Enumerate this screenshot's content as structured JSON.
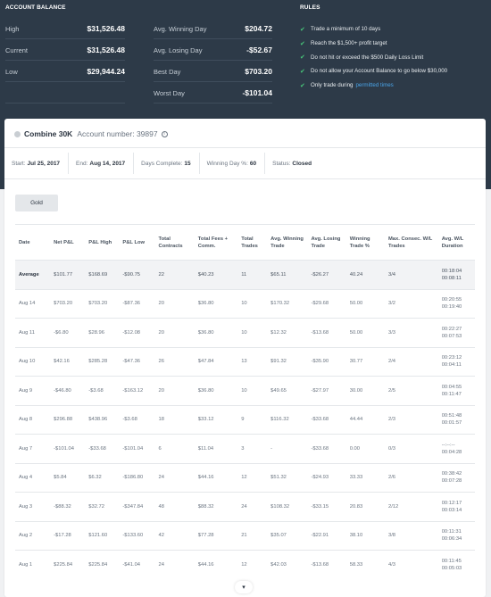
{
  "account_balance": {
    "title": "ACCOUNT BALANCE",
    "left": [
      {
        "label": "High",
        "value": "$31,526.48"
      },
      {
        "label": "Current",
        "value": "$31,526.48"
      },
      {
        "label": "Low",
        "value": "$29,944.24"
      }
    ],
    "right": [
      {
        "label": "Avg. Winning Day",
        "value": "$204.72"
      },
      {
        "label": "Avg. Losing Day",
        "value": "-$52.67"
      },
      {
        "label": "Best Day",
        "value": "$703.20"
      },
      {
        "label": "Worst Day",
        "value": "-$101.04"
      }
    ]
  },
  "rules": {
    "title": "RULES",
    "items": [
      "Trade a minimum of 10 days",
      "Reach the $1,500+ profit target",
      "Do not hit or exceed the $500 Daily Loss Limit",
      "Do not allow your Account Balance to go below $30,000",
      "Only trade during"
    ],
    "link": "permitted times",
    "check_color": "#48c77a",
    "link_color": "#4aa4e8"
  },
  "combine": {
    "name": "Combine 30K",
    "account_label": "Account number: 39897",
    "start_label": "Start:",
    "start": "Jul 25, 2017",
    "end_label": "End:",
    "end": "Aug 14, 2017",
    "days_label": "Days Complete:",
    "days": "15",
    "win_label": "Winning Day %:",
    "win": "60",
    "status_label": "Status:",
    "status": "Closed",
    "gold_button": "Gold"
  },
  "table": {
    "headers": [
      "Date",
      "Net P&L",
      "P&L High",
      "P&L Low",
      "Total Contracts",
      "Total Fees + Comm.",
      "Total Trades",
      "Avg. Winning Trade",
      "Avg. Losing Trade",
      "Winning Trade %",
      "Max. Consec. W/L Trades",
      "Avg. W/L Duration"
    ],
    "rows": [
      [
        "Average",
        "$101.77",
        "$168.69",
        "-$90.75",
        "22",
        "$40.23",
        "11",
        "$65.11",
        "-$26.27",
        "40.24",
        "3/4",
        "00:18:04\n00:08:11"
      ],
      [
        "Aug 14",
        "$703.20",
        "$703.20",
        "-$87.36",
        "20",
        "$36.80",
        "10",
        "$170.32",
        "-$29.68",
        "50.00",
        "3/2",
        "00:20:55\n00:19:40"
      ],
      [
        "Aug 11",
        "-$6.80",
        "$28.96",
        "-$12.08",
        "20",
        "$36.80",
        "10",
        "$12.32",
        "-$13.68",
        "50.00",
        "3/3",
        "00:22:27\n00:07:53"
      ],
      [
        "Aug 10",
        "$42.16",
        "$285.28",
        "-$47.36",
        "26",
        "$47.84",
        "13",
        "$91.32",
        "-$35.90",
        "30.77",
        "2/4",
        "00:23:12\n00:04:11"
      ],
      [
        "Aug 9",
        "-$46.80",
        "-$3.68",
        "-$163.12",
        "20",
        "$36.80",
        "10",
        "$49.65",
        "-$27.97",
        "30.00",
        "2/5",
        "00:04:55\n00:11:47"
      ],
      [
        "Aug 8",
        "$296.88",
        "$438.96",
        "-$3.68",
        "18",
        "$33.12",
        "9",
        "$116.32",
        "-$33.68",
        "44.44",
        "2/3",
        "00:51:48\n00:01:57"
      ],
      [
        "Aug 7",
        "-$101.04",
        "-$33.68",
        "-$101.04",
        "6",
        "$11.04",
        "3",
        "-",
        "-$33.68",
        "0.00",
        "0/3",
        "--:--:--\n00:04:28"
      ],
      [
        "Aug 4",
        "$5.84",
        "$6.32",
        "-$186.80",
        "24",
        "$44.16",
        "12",
        "$51.32",
        "-$24.93",
        "33.33",
        "2/6",
        "00:38:42\n00:07:28"
      ],
      [
        "Aug 3",
        "-$88.32",
        "$32.72",
        "-$347.84",
        "48",
        "$88.32",
        "24",
        "$108.32",
        "-$33.15",
        "20.83",
        "2/12",
        "00:12:17\n00:03:14"
      ],
      [
        "Aug 2",
        "-$17.28",
        "$121.60",
        "-$133.60",
        "42",
        "$77.28",
        "21",
        "$35.07",
        "-$22.91",
        "38.10",
        "3/8",
        "00:11:31\n00:06:34"
      ],
      [
        "Aug 1",
        "$225.84",
        "$225.84",
        "-$41.04",
        "24",
        "$44.16",
        "12",
        "$42.03",
        "-$13.68",
        "58.33",
        "4/3",
        "00:11:45\n00:05:03"
      ]
    ]
  }
}
